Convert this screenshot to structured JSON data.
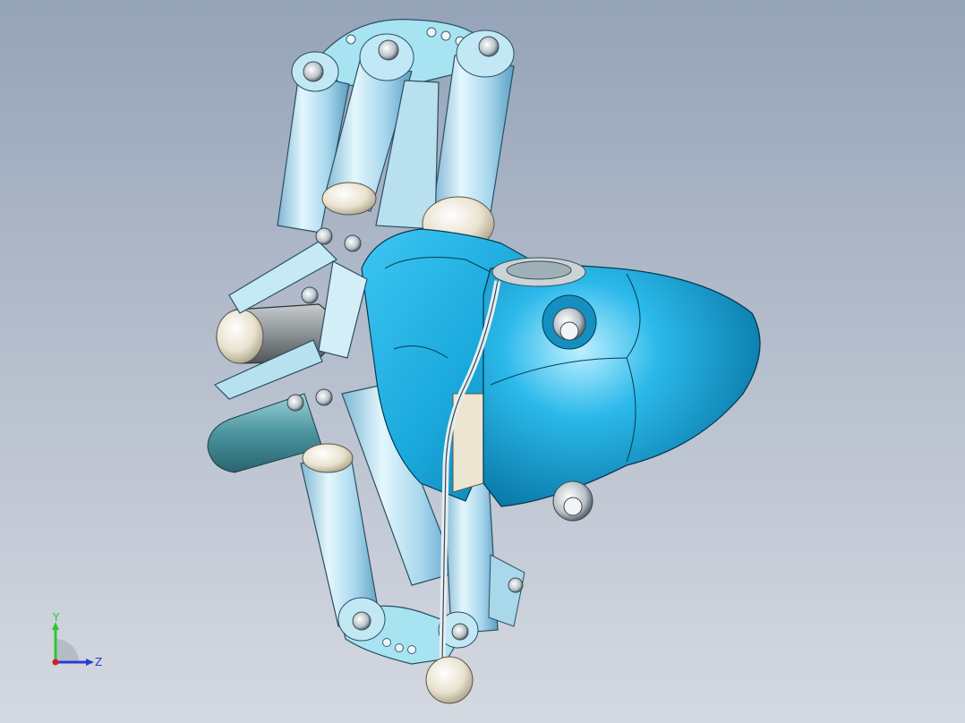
{
  "viewport": {
    "background_top": "#95a3b8",
    "background_bottom": "#d5d9e1"
  },
  "model": {
    "parts": [
      "finger-links",
      "palm-base",
      "wrist-housing",
      "thumb-pad",
      "tendon-cable",
      "fingertip-ball",
      "pivot-screws"
    ],
    "colors": {
      "link_light": "#c9eefb",
      "link_mid": "#9fd3ec",
      "link_dark": "#5c9fc2",
      "housing": "#1eb2e6",
      "housing_dark": "#0a7fb0",
      "thumb_grey": "#8c9296",
      "joint_cream": "#f1ecdd",
      "palm_teal": "#3f8a96"
    }
  },
  "triad": {
    "y_label": "Y",
    "z_label": "Z",
    "y_color": "#2ec82e",
    "z_color": "#2b3bd6",
    "x_color": "#d42020"
  }
}
